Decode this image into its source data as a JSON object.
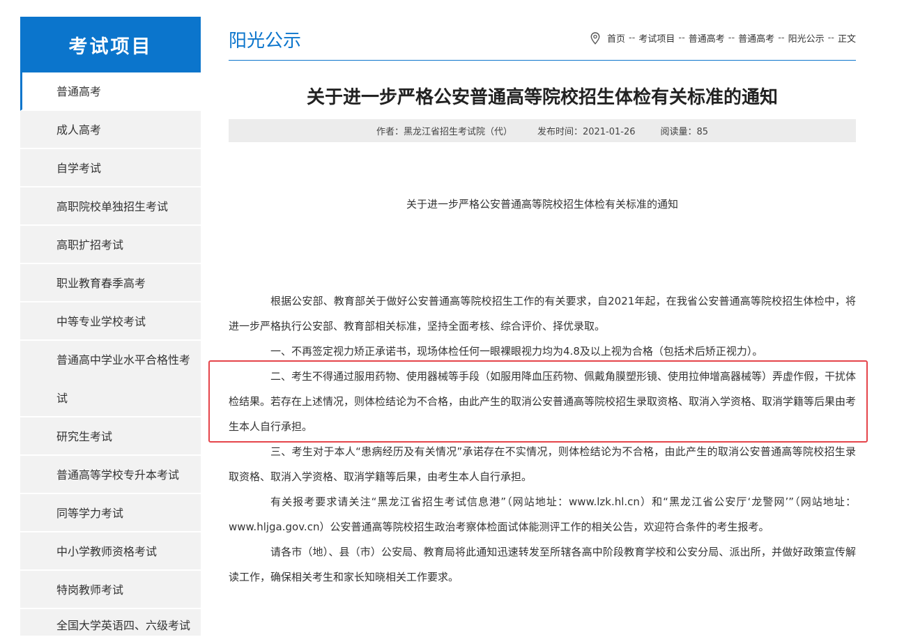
{
  "sidebar": {
    "title": "考试项目",
    "items": [
      {
        "label": "普通高考"
      },
      {
        "label": "成人高考"
      },
      {
        "label": "自学考试"
      },
      {
        "label": "高职院校单独招生考试"
      },
      {
        "label": "高职扩招考试"
      },
      {
        "label": "职业教育春季高考"
      },
      {
        "label": "中等专业学校考试"
      },
      {
        "label": "普通高中学业水平合格性考试"
      },
      {
        "label": "研究生考试"
      },
      {
        "label": "普通高等学校专升本考试"
      },
      {
        "label": "同等学力考试"
      },
      {
        "label": "中小学教师资格考试"
      },
      {
        "label": "特岗教师考试"
      },
      {
        "label": "全国大学英语四、六级考试"
      }
    ]
  },
  "header": {
    "section_title": "阳光公示",
    "breadcrumb": [
      "首页",
      "考试项目",
      "普通高考",
      "普通高考",
      "阳光公示",
      "正文"
    ],
    "separator": "--"
  },
  "article": {
    "title": "关于进一步严格公安普通高等院校招生体检有关标准的通知",
    "author": "作者：黑龙江省招生考试院（代）",
    "date": "发布时间：2021-01-26",
    "views": "阅读量：85",
    "doc_title": "关于进一步严格公安普通高等院校招生体检有关标准的通知",
    "paragraphs": [
      "根据公安部、教育部关于做好公安普通高等院校招生工作的有关要求，自2021年起，在我省公安普通高等院校招生体检中，将进一步严格执行公安部、教育部相关标准，坚持全面考核、综合评价、择优录取。",
      "一、不再签定视力矫正承诺书，现场体检任何一眼裸眼视力均为4.8及以上视为合格（包括术后矫正视力）。",
      "二、考生不得通过服用药物、使用器械等手段（如服用降血压药物、佩戴角膜塑形镜、使用拉伸增高器械等）弄虚作假，干扰体检结果。若存在上述情况，则体检结论为不合格，由此产生的取消公安普通高等院校招生录取资格、取消入学资格、取消学籍等后果由考生本人自行承担。",
      "三、考生对于本人“患病经历及有关情况”承诺存在不实情况，则体检结论为不合格，由此产生的取消公安普通高等院校招生录取资格、取消入学资格、取消学籍等后果，由考生本人自行承担。",
      "有关报考要求请关注“黑龙江省招生考试信息港”（网站地址：www.lzk.hl.cn）和“黑龙江省公安厅‘龙警网’”（网站地址：www.hljga.gov.cn）公安普通高等院校招生政治考察体检面试体能测评工作的相关公告，欢迎符合条件的考生报考。",
      "请各市（地）、县（市）公安局、教育局将此通知迅速转发至所辖各高中阶段教育学校和公安分局、派出所，并做好政策宣传解读工作，确保相关考生和家长知晓相关工作要求。"
    ]
  },
  "colors": {
    "brand": "#0b75cc",
    "highlight": "#e5444a",
    "meta_bg": "#ececec"
  },
  "icons": {
    "breadcrumb": "location-pin-icon"
  }
}
